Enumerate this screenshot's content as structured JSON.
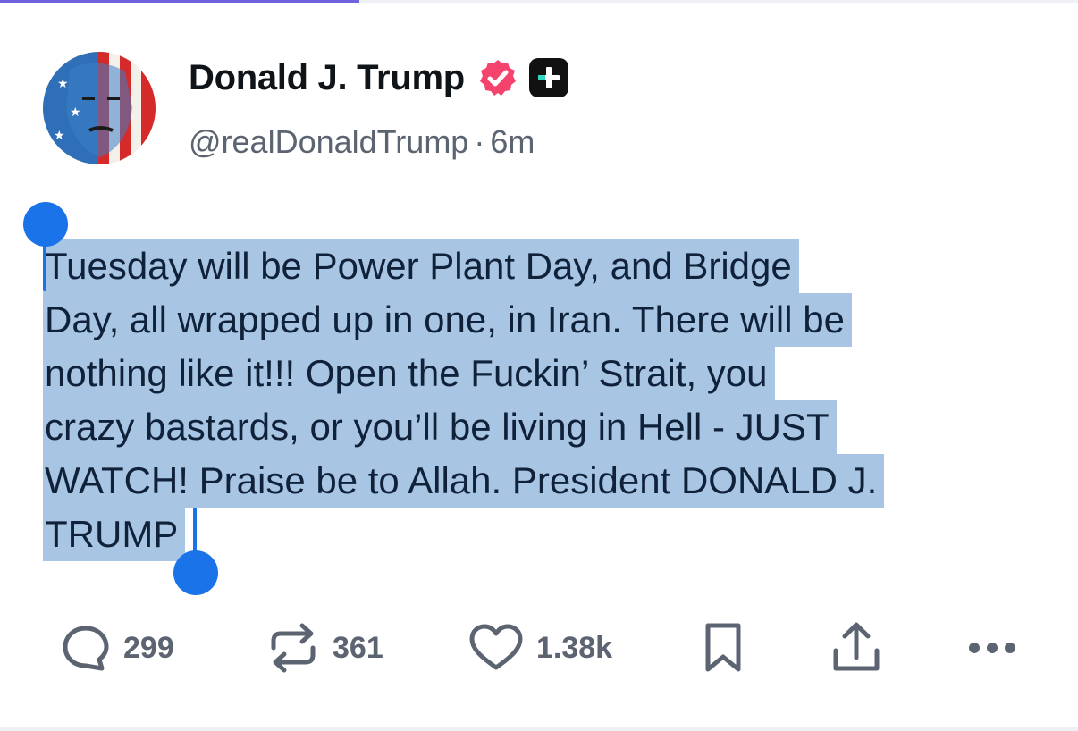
{
  "post": {
    "author": {
      "display_name": "Donald J. Trump",
      "handle": "@realDonaldTrump",
      "separator": "·",
      "age": "6m"
    },
    "text_lines": [
      "Tuesday will be Power Plant Day, and Bridge",
      "Day, all wrapped up in one, in Iran. There will be",
      "nothing like it!!! Open the Fuckin’ Strait, you",
      "crazy bastards, or you’ll be living in Hell - JUST",
      "WATCH! Praise be to Allah. President DONALD J.",
      "TRUMP"
    ],
    "selection_color": "#a8c5e3",
    "selection_handle_color": "#1a73e8"
  },
  "actions": {
    "reply_count": "299",
    "repost_count": "361",
    "like_count": "1.38k",
    "icons": [
      "reply-icon",
      "repost-icon",
      "like-icon",
      "bookmark-icon",
      "share-icon",
      "more-icon"
    ]
  },
  "badges": {
    "verified_color": "#f4436c",
    "plus_badge_color": "#111111"
  }
}
